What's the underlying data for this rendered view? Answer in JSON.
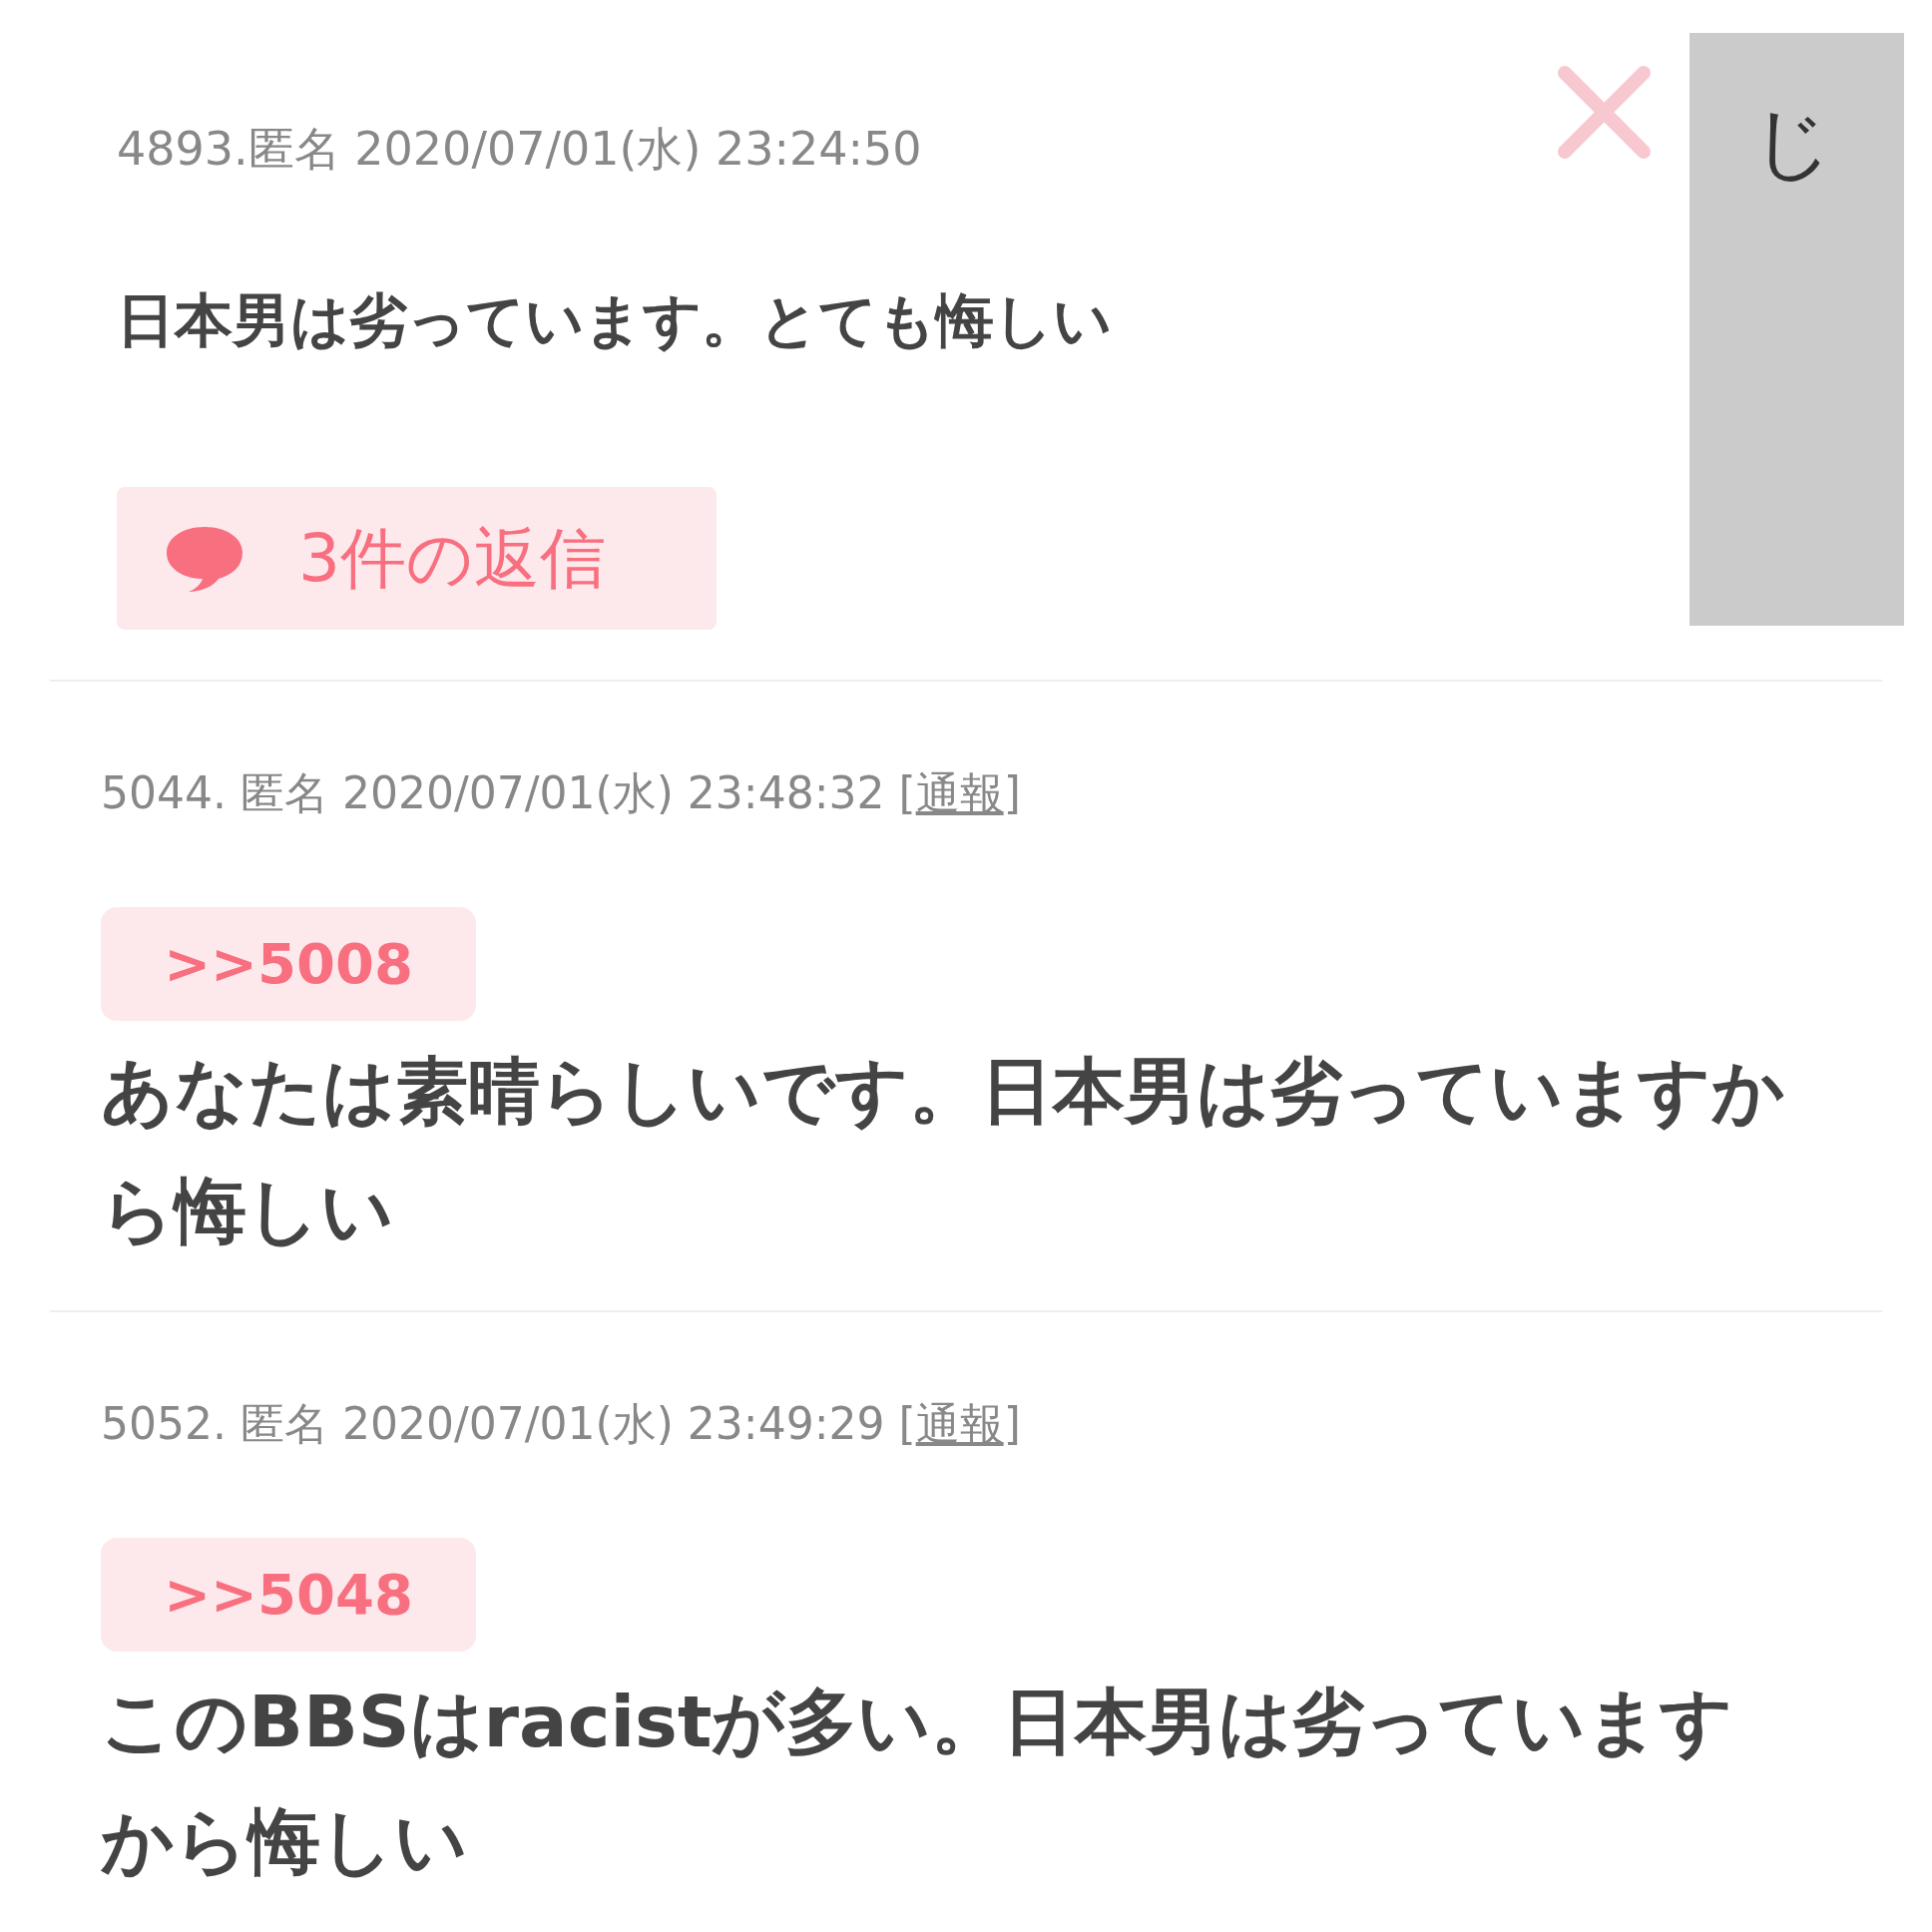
{
  "posts": [
    {
      "kind": "parent",
      "header": "4893.匿名 2020/07/01(水) 23:24:50",
      "body": "日本男は劣っています。とても悔しい",
      "replies": "3件の返信"
    },
    {
      "kind": "reply",
      "header": "5044. 匿名 2020/07/01(水) 23:48:32",
      "report": {
        "open": "[",
        "label": "通報",
        "close": "]"
      },
      "quote": ">>5008",
      "body": "あなたは素晴らしいです。日本男は劣っていますから悔しい"
    },
    {
      "kind": "reply",
      "header": "5052. 匿名 2020/07/01(水) 23:49:29",
      "report": {
        "open": "[",
        "label": "通報",
        "close": "]"
      },
      "quote": ">>5048",
      "body": "このBBSはracistが多い。日本男は劣っていますから悔しい"
    }
  ],
  "side_panel": {
    "text": "じ"
  }
}
